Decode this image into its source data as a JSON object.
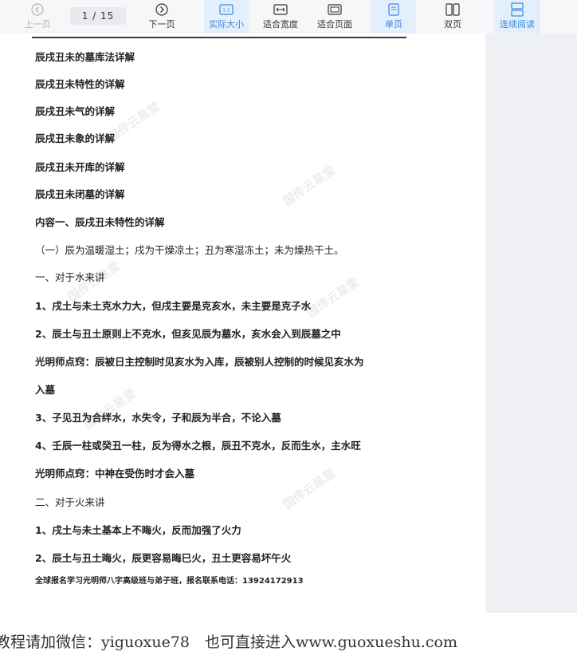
{
  "toolbar": {
    "prev_label": "上一页",
    "page_indicator": "1 / 15",
    "next_label": "下一页",
    "actual_size_label": "实际大小",
    "fit_width_label": "适合宽度",
    "fit_page_label": "适合页面",
    "single_page_label": "单页",
    "double_page_label": "双页",
    "continuous_label": "连续阅读",
    "accent_color": "#3d86de"
  },
  "document": {
    "lines": [
      "辰戌丑未的墓库法详解",
      "辰戌丑未特性的详解",
      "辰戌丑未气的详解",
      "辰戌丑未象的详解",
      "辰戌丑未开库的详解",
      "辰戌丑未闭墓的详解",
      "内容一、辰戌丑未特性的详解",
      "（一）辰为温暖湿土；戌为干燥凉土；丑为寒湿冻土；未为燥热干土。",
      "一、对于水来讲",
      "1、戌土与未土克水力大，但戌主要是克亥水，未主要是克子水",
      "2、辰土与丑土原则上不克水，但亥见辰为墓水，亥水会入到辰墓之中",
      "光明师点窍：辰被日主控制时见亥水为入库，辰被别人控制的时候见亥水为",
      "入墓",
      "3、子见丑为合绊水，水失令，子和辰为半合，不论入墓",
      "4、壬辰一柱或癸丑一柱，反为得水之根，辰丑不克水，反而生水，主水旺",
      "光明师点窍：中神在受伤时才会入墓",
      "二、对于火来讲",
      "1、戌土与未土基本上不晦火，反而加强了火力",
      "2、辰土与丑土晦火，辰更容易晦巳火，丑土更容易坏午火"
    ],
    "footer": "全球报名学习光明师八字高级班与弟子班，报名联系电话：13924172913",
    "watermark": "国传云易堂"
  },
  "banner": {
    "text": "教程请加微信：yiguoxue78　也可直接进入www.guoxueshu.com"
  }
}
